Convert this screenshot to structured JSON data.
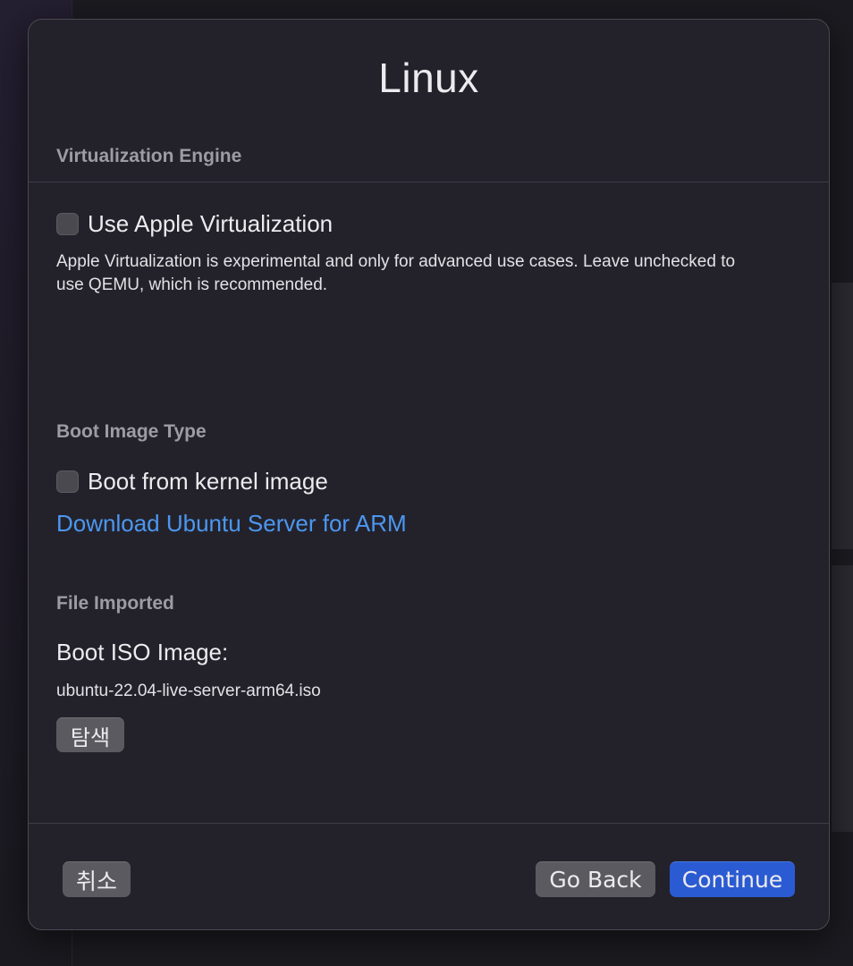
{
  "dialog": {
    "title": "Linux",
    "virtualization": {
      "header": "Virtualization Engine",
      "checkbox_label": "Use Apple Virtualization",
      "checked": false,
      "help": "Apple Virtualization is experimental and only for advanced use cases. Leave unchecked to use QEMU, which is recommended."
    },
    "boot_image": {
      "header": "Boot Image Type",
      "checkbox_label": "Boot from kernel image",
      "checked": false,
      "link": "Download Ubuntu Server for ARM"
    },
    "file": {
      "header": "File Imported",
      "label": "Boot ISO Image:",
      "filename": "ubuntu-22.04-live-server-arm64.iso",
      "browse_label": "탐색"
    },
    "footer": {
      "cancel_label": "취소",
      "back_label": "Go Back",
      "continue_label": "Continue"
    }
  },
  "colors": {
    "accent": "#2b5bd2",
    "link": "#4c97f0"
  }
}
